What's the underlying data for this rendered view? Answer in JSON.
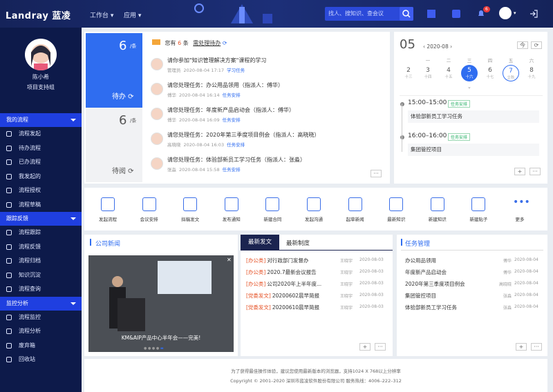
{
  "header": {
    "logo": "Landray 蓝凌",
    "nav": [
      "工作台",
      "应用"
    ],
    "search_placeholder": "找人、搜知识、查会议",
    "notification_count": "6"
  },
  "user": {
    "name": "陈小希",
    "role": "项目支持组"
  },
  "sidebar": {
    "sections": [
      {
        "title": "我的流程",
        "items": [
          "流程发起",
          "待办流程",
          "已办流程",
          "我发起的",
          "流程授权",
          "流程草稿"
        ]
      },
      {
        "title": "跟踪反馈",
        "items": [
          "流程跟踪",
          "流程反馈",
          "流程归档",
          "知识沉淀",
          "流程查询"
        ]
      },
      {
        "title": "监控分析",
        "items": [
          "流程监控",
          "流程分析",
          "废弃箱",
          "回收站"
        ]
      }
    ]
  },
  "todo": {
    "count": "6",
    "unit": "/条",
    "label": "待办",
    "read_count": "6",
    "read_label": "待阅",
    "summary_pre": "您有",
    "summary_num": "6",
    "summary_post": "条",
    "summary_link": "需处理待办",
    "tasks": [
      {
        "title": "请你参加\"知识管理解决方案\"课程的学习",
        "person": "管理员",
        "time": "2020-08-04 17:17",
        "tag": "学习任务"
      },
      {
        "title": "请您处理任务：办公用品领用（指派人：傅华）",
        "person": "傅华",
        "time": "2020-08-04 16:14",
        "tag": "任务安排"
      },
      {
        "title": "请您处理任务：年度新产品启动会（指派人：傅华）",
        "person": "傅华",
        "time": "2020-08-04 16:09",
        "tag": "任务安排"
      },
      {
        "title": "请您处理任务：2020年第三季度项目例会（指派人：高晓晓）",
        "person": "高晓晓",
        "time": "2020-08-04 16:03",
        "tag": "任务安排"
      },
      {
        "title": "请您处理任务：体验部新员工学习任务（指派人：张淼）",
        "person": "张淼",
        "time": "2020-08-04 15:58",
        "tag": "任务安排"
      }
    ]
  },
  "calendar": {
    "day": "05",
    "month": "2020-08",
    "weekdays": [
      "一",
      "二",
      "三",
      "四",
      "五",
      "六"
    ],
    "dates": [
      {
        "n": "2",
        "l": "十三"
      },
      {
        "n": "3",
        "l": "十四"
      },
      {
        "n": "4",
        "l": "十五"
      },
      {
        "n": "5",
        "l": "十六"
      },
      {
        "n": "6",
        "l": "十七"
      },
      {
        "n": "7",
        "l": "立秋"
      },
      {
        "n": "8",
        "l": "十九"
      }
    ],
    "events": [
      {
        "time": "15:00–15:00",
        "tag": "任务安排",
        "title": "体验部新员工学习任务"
      },
      {
        "time": "16:00–16:00",
        "tag": "任务安排",
        "title": "集团管控项目"
      }
    ]
  },
  "quick": [
    "发起流程",
    "会议安排",
    "拟稿发文",
    "发布通知",
    "新建合同",
    "发起沟通",
    "起草新闻",
    "最新知识",
    "新建知识",
    "新建贴子",
    "更多"
  ],
  "news": {
    "title": "公司新闻",
    "caption": "KM&AIP产品中心半年会——完美!"
  },
  "docs": {
    "tabs": [
      "最新发文",
      "最新制度"
    ],
    "rows": [
      {
        "cat": "[办公类]",
        "title": "对行政部门发督办",
        "author": "王晓宇",
        "date": "2020-08-03"
      },
      {
        "cat": "[办公类]",
        "title": "2020.7最新会议报告",
        "author": "王晓宇",
        "date": "2020-08-03"
      },
      {
        "cat": "[办公类]",
        "title": "公司2020年上半年度...",
        "author": "王晓宇",
        "date": "2020-08-03"
      },
      {
        "cat": "[党委发文]",
        "title": "20200602晨早简报",
        "author": "王晓宇",
        "date": "2020-08-03"
      },
      {
        "cat": "[党委发文]",
        "title": "20200610晨早简报",
        "author": "王晓宇",
        "date": "2020-08-03"
      }
    ]
  },
  "tasks": {
    "title": "任务管理",
    "rows": [
      {
        "title": "办公用品领用",
        "person": "傅华",
        "date": "2020-08-04"
      },
      {
        "title": "年度新产品启动会",
        "person": "傅华",
        "date": "2020-08-04"
      },
      {
        "title": "2020年第三季度项目例会",
        "person": "高晓晓",
        "date": "2020-08-04"
      },
      {
        "title": "集团管控项目",
        "person": "张淼",
        "date": "2020-08-04"
      },
      {
        "title": "体验部新员工学习任务",
        "person": "张淼",
        "date": "2020-08-04"
      }
    ]
  },
  "footer": {
    "line1": "为了获得最佳操作体验，建议您使用最新版本的浏览器，支持1024 X 768以上分辨率",
    "line2": "Copyright © 2001–2020 深圳市蓝凌软件股份有限公司 服务热线：4006–222–312"
  }
}
